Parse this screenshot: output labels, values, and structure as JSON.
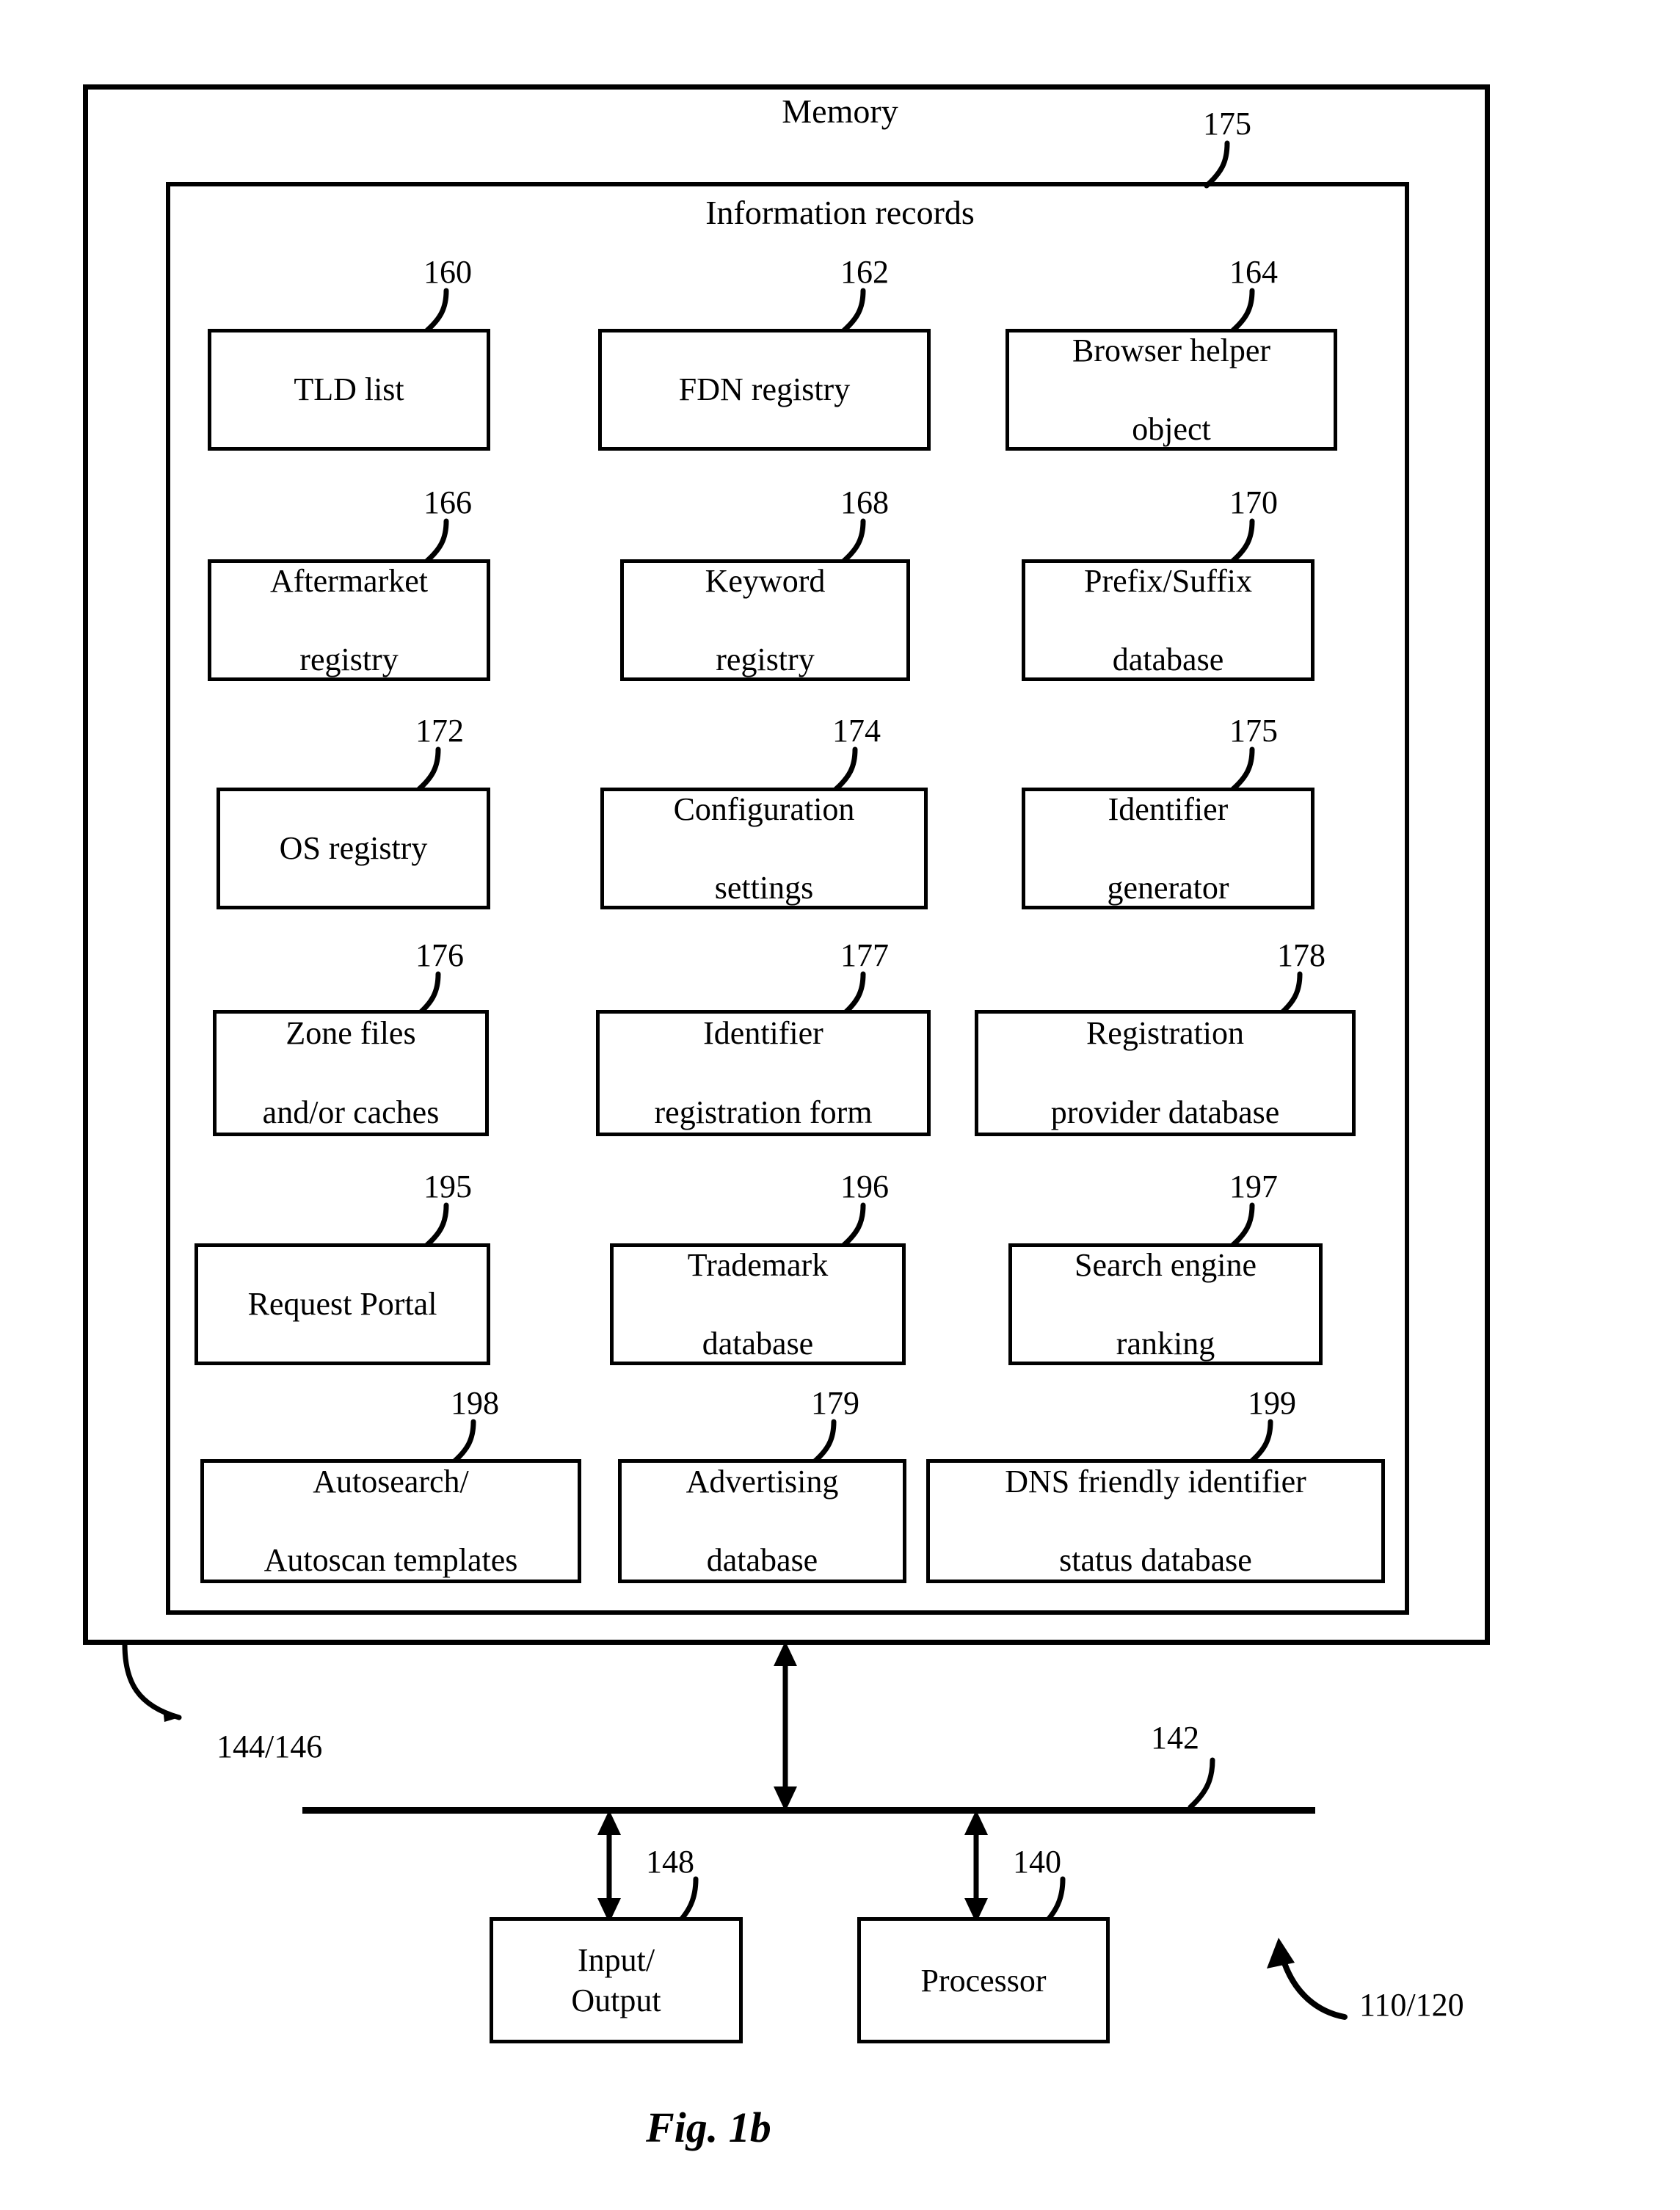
{
  "figure": {
    "caption": "Fig. 1b",
    "memory_title": "Memory",
    "records_title": "Information records",
    "memory_ref": "175",
    "system_ref": "110/120",
    "bus_ref": "142",
    "memory_bus_ref": "144/146",
    "io_bus_ref": "148",
    "processor_bus_ref": "140"
  },
  "records": [
    {
      "ref": "160",
      "label": "TLD list"
    },
    {
      "ref": "162",
      "label": "FDN registry"
    },
    {
      "ref": "164",
      "label": "Browser helper object",
      "lines": [
        "Browser helper",
        "object"
      ]
    },
    {
      "ref": "166",
      "label": "Aftermarket registry",
      "lines": [
        "Aftermarket",
        "registry"
      ]
    },
    {
      "ref": "168",
      "label": "Keyword registry",
      "lines": [
        "Keyword",
        "registry"
      ]
    },
    {
      "ref": "170",
      "label": "Prefix/Suffix database",
      "lines": [
        "Prefix/Suffix",
        "database"
      ]
    },
    {
      "ref": "172",
      "label": "OS registry"
    },
    {
      "ref": "174",
      "label": "Configuration settings",
      "lines": [
        "Configuration",
        "settings"
      ]
    },
    {
      "ref": "175",
      "label": "Identifier generator",
      "lines": [
        "Identifier",
        "generator"
      ]
    },
    {
      "ref": "176",
      "label": "Zone files and/or caches",
      "lines": [
        "Zone files",
        "and/or caches"
      ]
    },
    {
      "ref": "177",
      "label": "Identifier registration form",
      "lines": [
        "Identifier",
        "registration form"
      ]
    },
    {
      "ref": "178",
      "label": "Registration provider database",
      "lines": [
        "Registration",
        "provider database"
      ]
    },
    {
      "ref": "195",
      "label": "Request Portal"
    },
    {
      "ref": "196",
      "label": "Trademark database",
      "lines": [
        "Trademark",
        "database"
      ]
    },
    {
      "ref": "197",
      "label": "Search engine ranking",
      "lines": [
        "Search engine",
        "ranking"
      ]
    },
    {
      "ref": "198",
      "label": "Autosearch/ Autoscan templates",
      "lines": [
        "Autosearch/",
        "Autoscan templates"
      ]
    },
    {
      "ref": "179",
      "label": "Advertising database",
      "lines": [
        "Advertising",
        "database"
      ]
    },
    {
      "ref": "199",
      "label": "DNS friendly identifier status database",
      "lines": [
        "DNS friendly identifier",
        "status database"
      ]
    }
  ],
  "components": [
    {
      "ref": "148",
      "label": "Input/ Output",
      "lines": [
        "Input/",
        "Output"
      ]
    },
    {
      "ref": "140",
      "label": "Processor",
      "lines": [
        "Processor"
      ]
    }
  ]
}
